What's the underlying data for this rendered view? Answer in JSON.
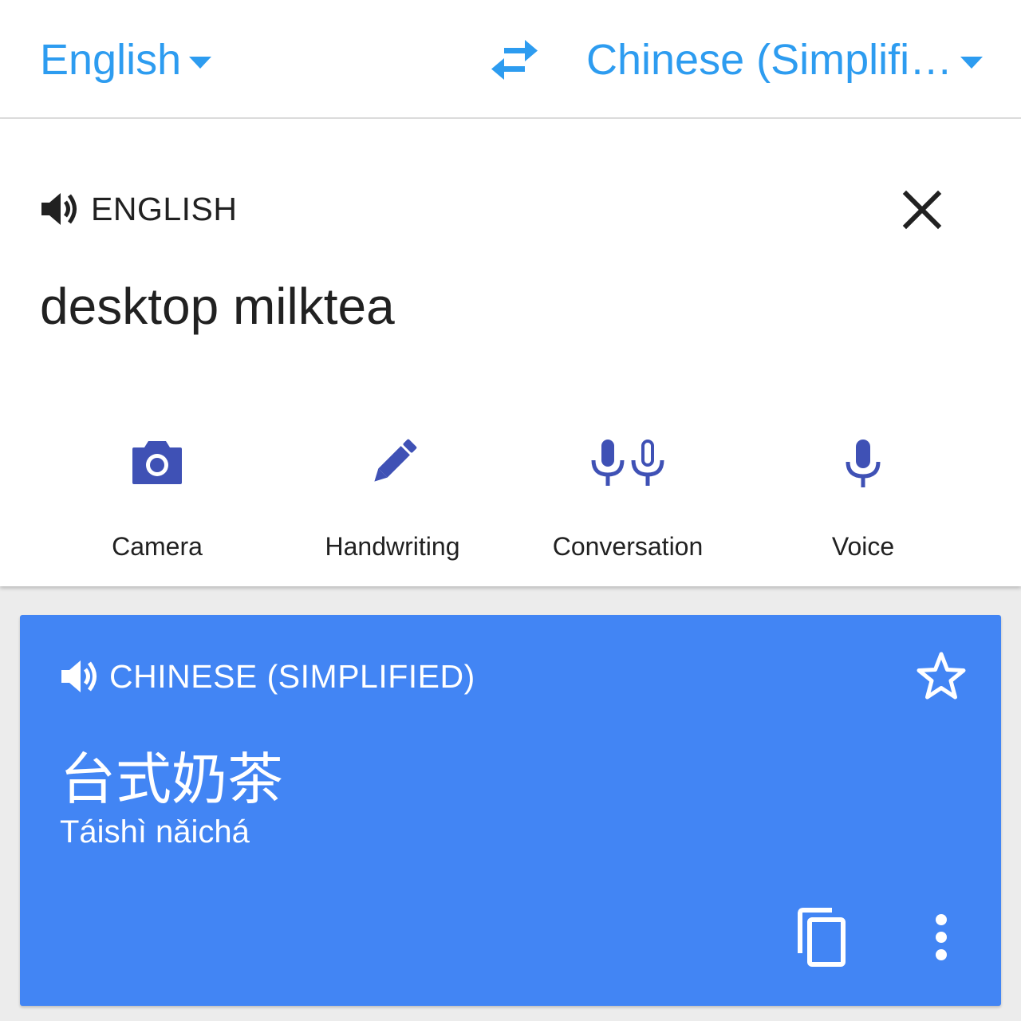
{
  "language_bar": {
    "source_language": "English",
    "target_language": "Chinese (Simplifi…",
    "swap_icon": "swap-arrows-icon",
    "dropdown_icon": "caret-down-icon"
  },
  "input_card": {
    "source_label": "ENGLISH",
    "speaker_icon": "speaker-icon",
    "clear_icon": "close-icon",
    "text": "desktop milktea",
    "tools": [
      {
        "label": "Camera",
        "icon": "camera-icon"
      },
      {
        "label": "Handwriting",
        "icon": "pen-icon"
      },
      {
        "label": "Conversation",
        "icon": "dual-mic-icon"
      },
      {
        "label": "Voice",
        "icon": "mic-icon"
      }
    ]
  },
  "result_card": {
    "target_label": "CHINESE (SIMPLIFIED)",
    "translation": "台式奶茶",
    "romanization": "Táishì nǎichá",
    "star_icon": "star-outline-icon",
    "copy_icon": "copy-icon",
    "more_icon": "more-vert-icon"
  },
  "colors": {
    "accent": "#2d9cf0",
    "tool_icon": "#3f51b5",
    "result_background": "#4285f4"
  }
}
